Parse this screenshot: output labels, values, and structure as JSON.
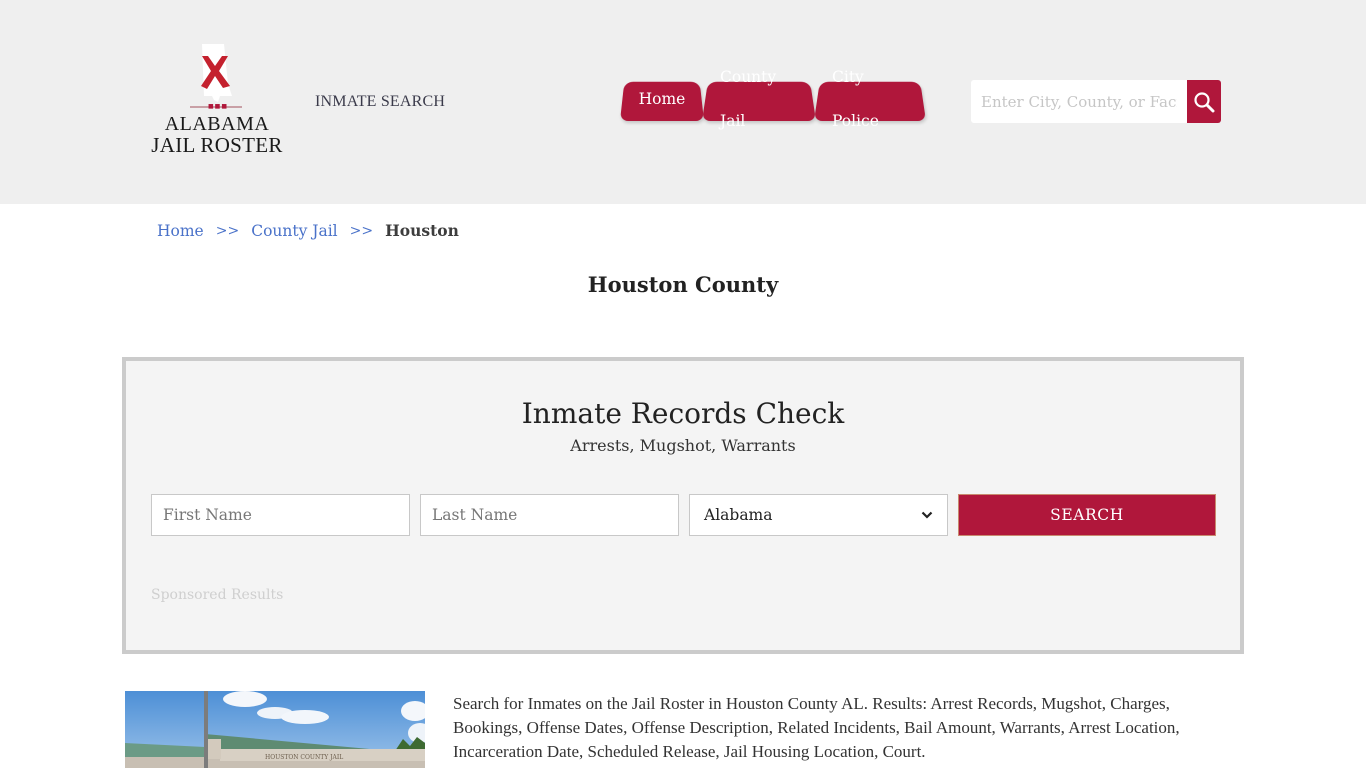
{
  "header": {
    "logo": {
      "line1": "ALABAMA",
      "line2": "JAIL ROSTER",
      "icon": "alabama-state-flag-icon",
      "accent_color": "#b0173b"
    },
    "inmate_search_link": "INMATE SEARCH",
    "nav": [
      {
        "label": "Home"
      },
      {
        "label": "County Jail"
      },
      {
        "label": "City Police"
      }
    ],
    "site_search": {
      "placeholder": "Enter City, County, or Facility",
      "value": "",
      "icon": "search-icon"
    }
  },
  "breadcrumb": {
    "items": [
      {
        "label": "Home"
      },
      {
        "label": "County Jail"
      }
    ],
    "separator": ">>",
    "current": "Houston"
  },
  "page_title": "Houston County",
  "records_panel": {
    "title": "Inmate Records Check",
    "subtitle": "Arrests, Mugshot, Warrants",
    "first_name": {
      "placeholder": "First Name",
      "value": ""
    },
    "last_name": {
      "placeholder": "Last Name",
      "value": ""
    },
    "state_select": {
      "selected": "Alabama"
    },
    "search_button": "SEARCH",
    "sponsored_label": "Sponsored Results"
  },
  "facility": {
    "photo_alt": "Houston County Jail building",
    "photo_sign_text": "HOUSTON COUNTY JAIL",
    "description": "Search for Inmates on the Jail Roster in Houston County AL. Results: Arrest Records, Mugshot, Charges, Bookings, Offense Dates, Offense Description, Related Incidents, Bail Amount, Warrants, Arrest Location, Incarceration Date, Scheduled Release, Jail Housing Location, Court."
  },
  "colors": {
    "brand": "#b0173b",
    "header_bg": "#efefef",
    "panel_bg": "#f4f4f4",
    "link": "#4a72c9"
  }
}
